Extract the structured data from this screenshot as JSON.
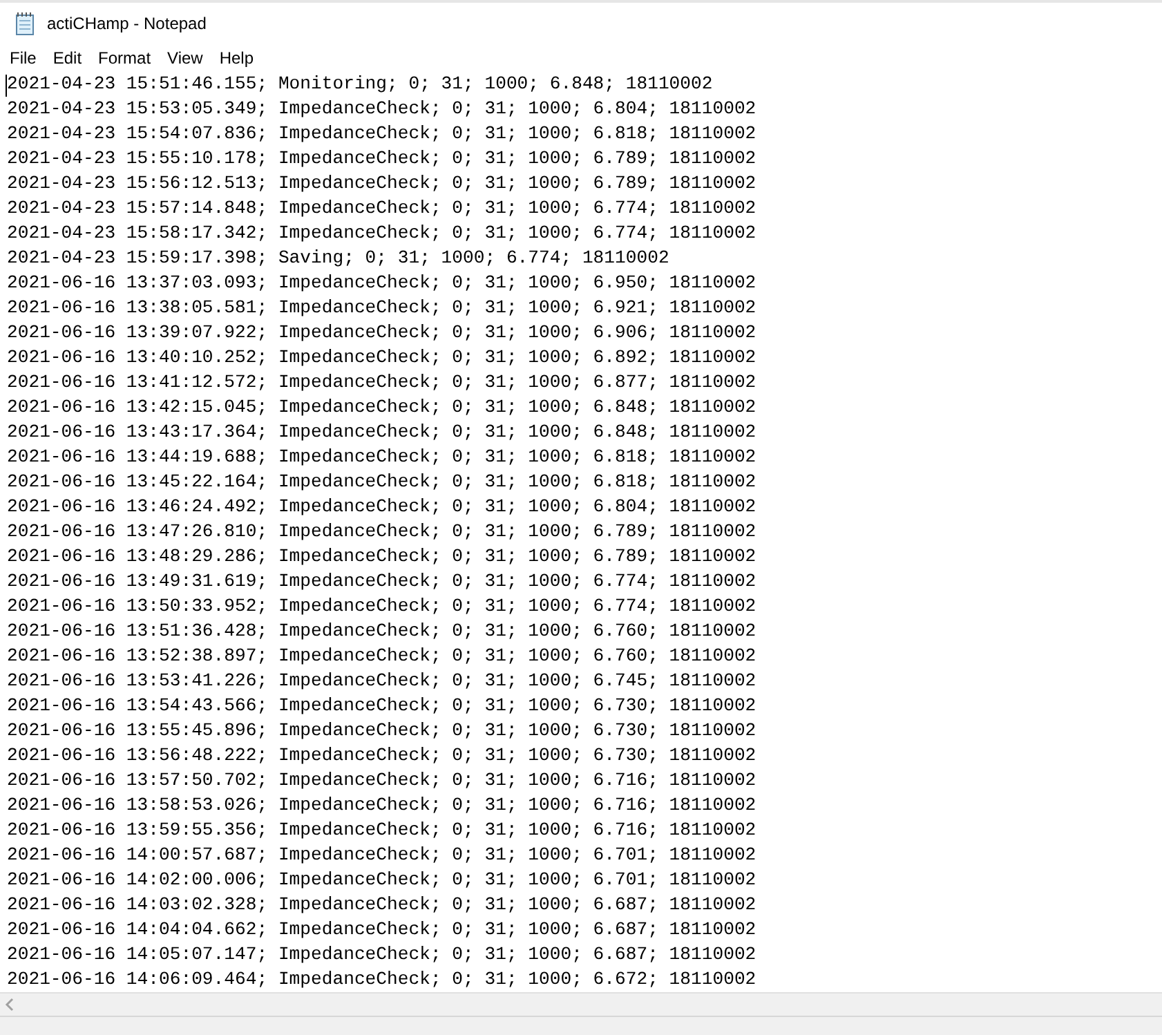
{
  "window": {
    "title": "actiCHamp - Notepad"
  },
  "menu": [
    {
      "label": "File"
    },
    {
      "label": "Edit"
    },
    {
      "label": "Format"
    },
    {
      "label": "View"
    },
    {
      "label": "Help"
    }
  ],
  "editor": {
    "lines": [
      "2021-04-23 15:51:46.155; Monitoring; 0; 31; 1000; 6.848; 18110002",
      "2021-04-23 15:53:05.349; ImpedanceCheck; 0; 31; 1000; 6.804; 18110002",
      "2021-04-23 15:54:07.836; ImpedanceCheck; 0; 31; 1000; 6.818; 18110002",
      "2021-04-23 15:55:10.178; ImpedanceCheck; 0; 31; 1000; 6.789; 18110002",
      "2021-04-23 15:56:12.513; ImpedanceCheck; 0; 31; 1000; 6.789; 18110002",
      "2021-04-23 15:57:14.848; ImpedanceCheck; 0; 31; 1000; 6.774; 18110002",
      "2021-04-23 15:58:17.342; ImpedanceCheck; 0; 31; 1000; 6.774; 18110002",
      "2021-04-23 15:59:17.398; Saving; 0; 31; 1000; 6.774; 18110002",
      "2021-06-16 13:37:03.093; ImpedanceCheck; 0; 31; 1000; 6.950; 18110002",
      "2021-06-16 13:38:05.581; ImpedanceCheck; 0; 31; 1000; 6.921; 18110002",
      "2021-06-16 13:39:07.922; ImpedanceCheck; 0; 31; 1000; 6.906; 18110002",
      "2021-06-16 13:40:10.252; ImpedanceCheck; 0; 31; 1000; 6.892; 18110002",
      "2021-06-16 13:41:12.572; ImpedanceCheck; 0; 31; 1000; 6.877; 18110002",
      "2021-06-16 13:42:15.045; ImpedanceCheck; 0; 31; 1000; 6.848; 18110002",
      "2021-06-16 13:43:17.364; ImpedanceCheck; 0; 31; 1000; 6.848; 18110002",
      "2021-06-16 13:44:19.688; ImpedanceCheck; 0; 31; 1000; 6.818; 18110002",
      "2021-06-16 13:45:22.164; ImpedanceCheck; 0; 31; 1000; 6.818; 18110002",
      "2021-06-16 13:46:24.492; ImpedanceCheck; 0; 31; 1000; 6.804; 18110002",
      "2021-06-16 13:47:26.810; ImpedanceCheck; 0; 31; 1000; 6.789; 18110002",
      "2021-06-16 13:48:29.286; ImpedanceCheck; 0; 31; 1000; 6.789; 18110002",
      "2021-06-16 13:49:31.619; ImpedanceCheck; 0; 31; 1000; 6.774; 18110002",
      "2021-06-16 13:50:33.952; ImpedanceCheck; 0; 31; 1000; 6.774; 18110002",
      "2021-06-16 13:51:36.428; ImpedanceCheck; 0; 31; 1000; 6.760; 18110002",
      "2021-06-16 13:52:38.897; ImpedanceCheck; 0; 31; 1000; 6.760; 18110002",
      "2021-06-16 13:53:41.226; ImpedanceCheck; 0; 31; 1000; 6.745; 18110002",
      "2021-06-16 13:54:43.566; ImpedanceCheck; 0; 31; 1000; 6.730; 18110002",
      "2021-06-16 13:55:45.896; ImpedanceCheck; 0; 31; 1000; 6.730; 18110002",
      "2021-06-16 13:56:48.222; ImpedanceCheck; 0; 31; 1000; 6.730; 18110002",
      "2021-06-16 13:57:50.702; ImpedanceCheck; 0; 31; 1000; 6.716; 18110002",
      "2021-06-16 13:58:53.026; ImpedanceCheck; 0; 31; 1000; 6.716; 18110002",
      "2021-06-16 13:59:55.356; ImpedanceCheck; 0; 31; 1000; 6.716; 18110002",
      "2021-06-16 14:00:57.687; ImpedanceCheck; 0; 31; 1000; 6.701; 18110002",
      "2021-06-16 14:02:00.006; ImpedanceCheck; 0; 31; 1000; 6.701; 18110002",
      "2021-06-16 14:03:02.328; ImpedanceCheck; 0; 31; 1000; 6.687; 18110002",
      "2021-06-16 14:04:04.662; ImpedanceCheck; 0; 31; 1000; 6.687; 18110002",
      "2021-06-16 14:05:07.147; ImpedanceCheck; 0; 31; 1000; 6.687; 18110002",
      "2021-06-16 14:06:09.464; ImpedanceCheck; 0; 31; 1000; 6.672; 18110002"
    ]
  }
}
